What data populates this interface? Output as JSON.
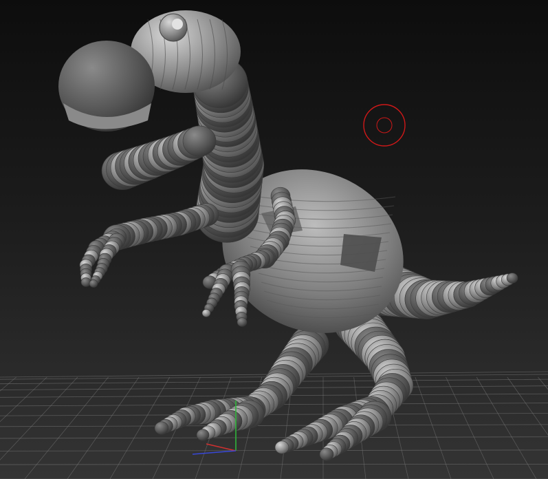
{
  "viewport": {
    "background_top": "#0d0d0d",
    "background_bottom": "#343434"
  },
  "model": {
    "name": "dinosaur-zsphere-model",
    "material_light": "#9a9a9a",
    "material_dark": "#555555",
    "material_highlight": "#d4d4d4"
  },
  "cursor": {
    "icon": "brush-cursor-icon",
    "color": "#d01818"
  },
  "axis_gizmo": {
    "x_color": "#d03030",
    "y_color": "#2fb53a",
    "z_color": "#3848d8"
  },
  "floor_grid": {
    "color": "#7d7d7d"
  }
}
